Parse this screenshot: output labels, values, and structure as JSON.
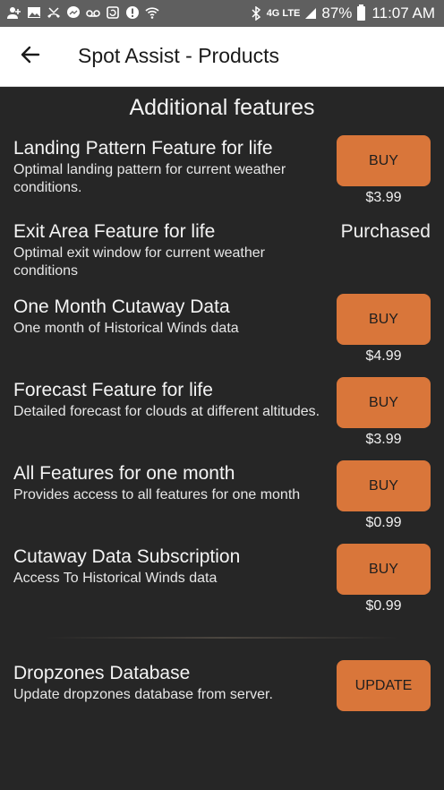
{
  "status_bar": {
    "left_icons": [
      "add-person-icon",
      "image-icon",
      "missed-call-icon",
      "messenger-icon",
      "voicemail-icon",
      "refresh-icon",
      "alert-icon",
      "wifi-calling-icon"
    ],
    "bluetooth": "bluetooth-icon",
    "network": "4G LTE",
    "signal": "signal-icon",
    "battery_pct": "87%",
    "time": "11:07 AM"
  },
  "toolbar": {
    "back_icon": "arrow-left-icon",
    "title": "Spot Assist - Products"
  },
  "section_title": "Additional features",
  "products": [
    {
      "title": "Landing Pattern Feature for life",
      "description": "Optimal landing pattern for current weather conditions.",
      "action": "BUY",
      "price": "$3.99"
    },
    {
      "title": "Exit Area Feature for life",
      "description": "Optimal exit window for current weather conditions",
      "status": "Purchased"
    },
    {
      "title": "One Month Cutaway Data",
      "description": "One month of Historical Winds data",
      "action": "BUY",
      "price": "$4.99"
    },
    {
      "title": "Forecast Feature for life",
      "description": "Detailed forecast for clouds at different altitudes.",
      "action": "BUY",
      "price": "$3.99"
    },
    {
      "title": "All Features for one month",
      "description": "Provides access to all features for one month",
      "action": "BUY",
      "price": "$0.99"
    },
    {
      "title": "Cutaway Data Subscription",
      "description": "Access To Historical Winds data",
      "action": "BUY",
      "price": "$0.99"
    }
  ],
  "database": {
    "title": "Dropzones Database",
    "description": "Update dropzones database from server.",
    "action": "UPDATE"
  },
  "colors": {
    "accent": "#d9763a",
    "background": "#262626",
    "status_bar": "#5f5f5f",
    "toolbar": "#ffffff"
  }
}
